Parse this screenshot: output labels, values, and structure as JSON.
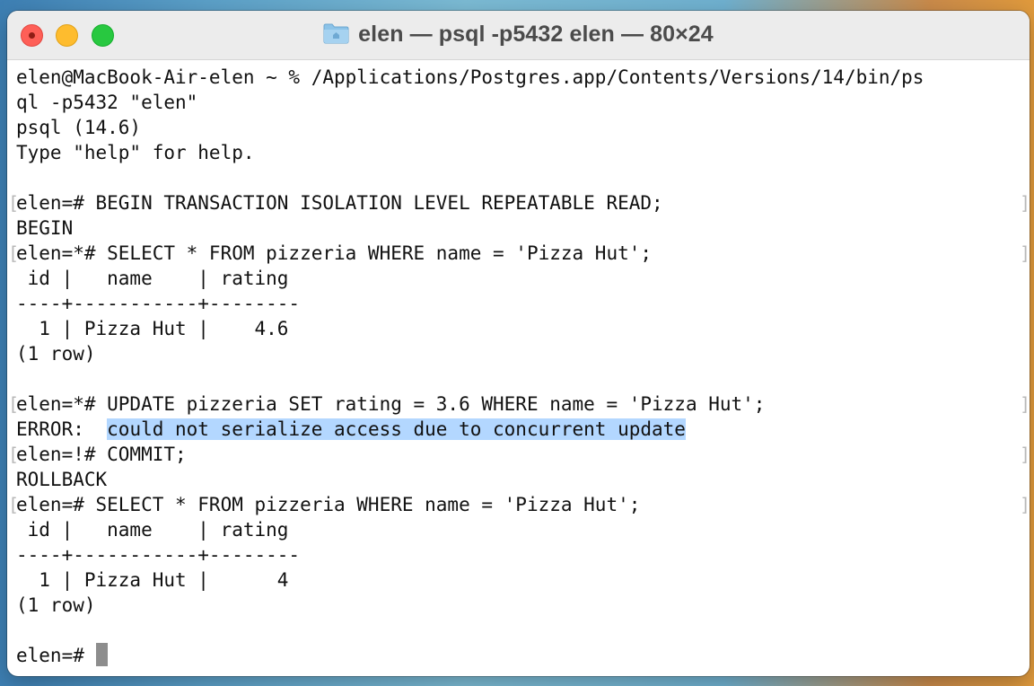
{
  "window": {
    "title": "elen — psql -p5432 elen — 80×24",
    "title_icon": "folder-icon"
  },
  "terminal": {
    "lines": [
      "elen@MacBook-Air-elen ~ % /Applications/Postgres.app/Contents/Versions/14/bin/ps",
      "ql -p5432 \"elen\"",
      "psql (14.6)",
      "Type \"help\" for help.",
      "",
      "elen=# BEGIN TRANSACTION ISOLATION LEVEL REPEATABLE READ;",
      "BEGIN",
      "elen=*# SELECT * FROM pizzeria WHERE name = 'Pizza Hut';",
      " id |   name    | rating",
      "----+-----------+--------",
      "  1 | Pizza Hut |    4.6",
      "(1 row)",
      "",
      "elen=*# UPDATE pizzeria SET rating = 3.6 WHERE name = 'Pizza Hut';",
      "ERROR:  could not serialize access due to concurrent update",
      "elen=!# COMMIT;",
      "ROLLBACK",
      "elen=# SELECT * FROM pizzeria WHERE name = 'Pizza Hut';",
      " id |   name    | rating",
      "----+-----------+--------",
      "  1 | Pizza Hut |      4",
      "(1 row)",
      "",
      "elen=# "
    ],
    "error_prefix": "ERROR:  ",
    "error_message": "could not serialize access due to concurrent update",
    "prompt": "elen=# ",
    "mark_left": "[",
    "mark_right": "]",
    "highlight_color": "#b3d7ff"
  }
}
